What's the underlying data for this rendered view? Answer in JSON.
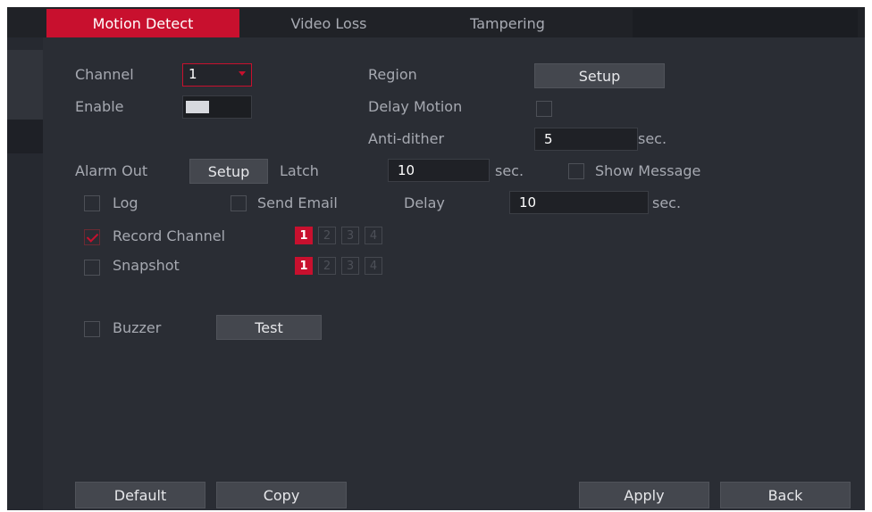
{
  "tabs": [
    {
      "label": "Motion Detect"
    },
    {
      "label": "Video Loss"
    },
    {
      "label": "Tampering"
    }
  ],
  "fields": {
    "channel_label": "Channel",
    "channel_value": "1",
    "enable_label": "Enable",
    "region_label": "Region",
    "region_button": "Setup",
    "delay_motion_label": "Delay Motion",
    "anti_dither_label": "Anti-dither",
    "anti_dither_value": "5",
    "anti_dither_unit": "sec.",
    "alarm_out_label": "Alarm Out",
    "alarm_out_button": "Setup",
    "latch_label": "Latch",
    "latch_value": "10",
    "latch_unit": "sec.",
    "show_message_label": "Show Message",
    "log_label": "Log",
    "send_email_label": "Send Email",
    "delay_label": "Delay",
    "delay_value": "10",
    "delay_unit": "sec.",
    "record_channel_label": "Record Channel",
    "snapshot_label": "Snapshot",
    "buzzer_label": "Buzzer",
    "test_button": "Test"
  },
  "record_channels": [
    "1",
    "2",
    "3",
    "4"
  ],
  "snapshot_channels": [
    "1",
    "2",
    "3",
    "4"
  ],
  "footer": {
    "default": "Default",
    "copy": "Copy",
    "apply": "Apply",
    "back": "Back"
  },
  "colors": {
    "accent": "#c8102e",
    "panel": "#2a2d34"
  }
}
